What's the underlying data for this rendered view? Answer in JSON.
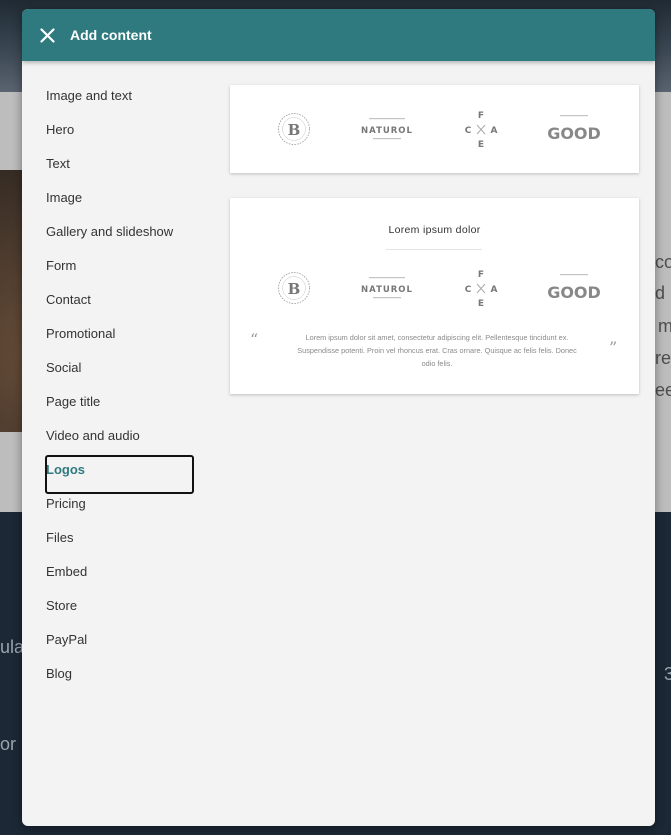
{
  "modal": {
    "title": "Add content",
    "close_icon": "close-icon"
  },
  "menu": {
    "items": [
      {
        "label": "Image and text"
      },
      {
        "label": "Hero"
      },
      {
        "label": "Text"
      },
      {
        "label": "Image"
      },
      {
        "label": "Gallery and slideshow"
      },
      {
        "label": "Form"
      },
      {
        "label": "Contact"
      },
      {
        "label": "Promotional"
      },
      {
        "label": "Social"
      },
      {
        "label": "Page title"
      },
      {
        "label": "Video and audio"
      },
      {
        "label": "Logos",
        "selected": true
      },
      {
        "label": "Pricing"
      },
      {
        "label": "Files"
      },
      {
        "label": "Embed"
      },
      {
        "label": "Store"
      },
      {
        "label": "PayPal"
      },
      {
        "label": "Blog"
      }
    ]
  },
  "logos": [
    {
      "icon": "b-monogram-logo",
      "text": "B"
    },
    {
      "icon": "naturol-logo",
      "text": "NATUROL"
    },
    {
      "icon": "cafe-logo",
      "text": "CAFE"
    },
    {
      "icon": "good-logo",
      "text": "GOOD"
    }
  ],
  "preview_card": {
    "heading": "Lorem ipsum dolor",
    "open_quote": "“",
    "close_quote": "”",
    "quote": "Lorem ipsum dolor sit amet, consectetur adipiscing elit. Pellentesque tincidunt ex. Suspendisse potenti. Proin vel rhoncus erat. Cras ornare. Quisque ac felis felis. Donec odio felis."
  },
  "background": {
    "fragments": [
      "co",
      "d",
      "m",
      "rec",
      "ee",
      "ula",
      "or",
      "3"
    ]
  },
  "colors": {
    "header": "#2e7a7f",
    "panel": "#f3f3f3",
    "selected_label": "#2e7a7f",
    "logo_gray": "#888888"
  }
}
